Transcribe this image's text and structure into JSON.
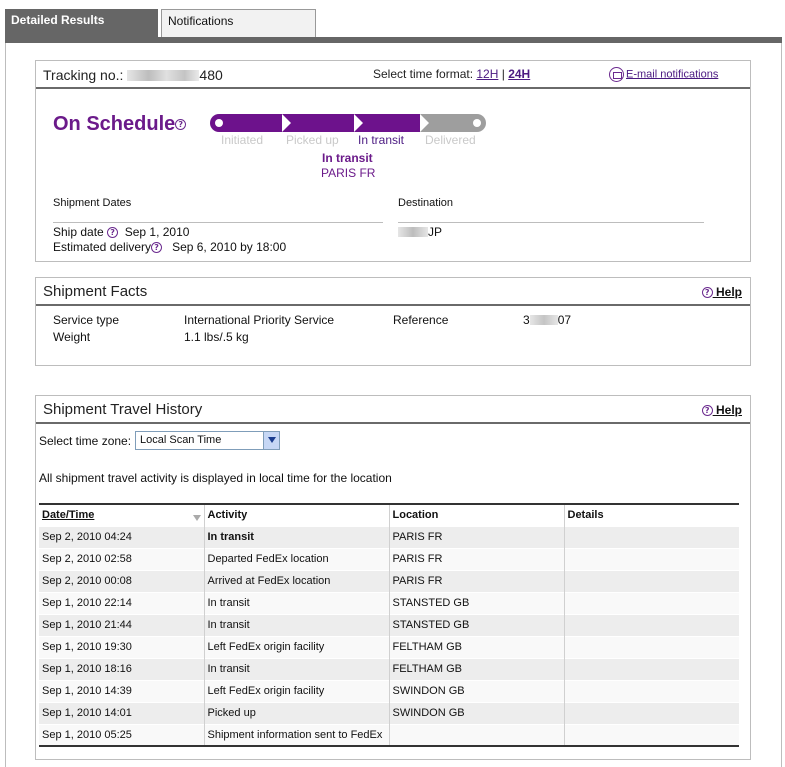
{
  "tabs": {
    "active": "Detailed Results",
    "inactive": "Notifications"
  },
  "tracking": {
    "label": "Tracking no.:",
    "number_suffix": "480",
    "time_format_label": "Select time format:",
    "format_12h": "12H",
    "separator": "|",
    "format_24h": "24H",
    "email_link": "E-mail notifications"
  },
  "status": {
    "title": "On Schedule",
    "steps": [
      "Initiated",
      "Picked up",
      "In transit",
      "Delivered"
    ],
    "current_status": "In transit",
    "current_location": "PARIS FR"
  },
  "shipment_dates": {
    "header": "Shipment Dates",
    "ship_date_label": "Ship date",
    "ship_date": "Sep 1, 2010",
    "est_delivery_label": "Estimated delivery",
    "est_delivery": "Sep 6, 2010 by 18:00"
  },
  "destination": {
    "header": "Destination",
    "value_suffix": "JP"
  },
  "facts": {
    "title": "Shipment Facts",
    "help": "Help",
    "service_type_label": "Service type",
    "service_type": "International Priority Service",
    "weight_label": "Weight",
    "weight": "1.1 lbs/.5 kg",
    "reference_label": "Reference",
    "reference_prefix": "3",
    "reference_suffix": "07"
  },
  "history": {
    "title": "Shipment Travel History",
    "help": "Help",
    "timezone_label": "Select time zone:",
    "timezone_value": "Local Scan Time",
    "note": "All shipment travel activity is displayed in local time for the location",
    "columns": [
      "Date/Time",
      "Activity",
      "Location",
      "Details"
    ],
    "rows": [
      {
        "datetime": "Sep 2, 2010 04:24",
        "activity": "In transit",
        "location": "PARIS FR",
        "details": ""
      },
      {
        "datetime": "Sep 2, 2010 02:58",
        "activity": "Departed FedEx location",
        "location": "PARIS FR",
        "details": ""
      },
      {
        "datetime": "Sep 2, 2010 00:08",
        "activity": "Arrived at FedEx location",
        "location": "PARIS FR",
        "details": ""
      },
      {
        "datetime": "Sep 1, 2010 22:14",
        "activity": "In transit",
        "location": "STANSTED GB",
        "details": ""
      },
      {
        "datetime": "Sep 1, 2010 21:44",
        "activity": "In transit",
        "location": "STANSTED GB",
        "details": ""
      },
      {
        "datetime": "Sep 1, 2010 19:30",
        "activity": "Left FedEx origin facility",
        "location": "FELTHAM GB",
        "details": ""
      },
      {
        "datetime": "Sep 1, 2010 18:16",
        "activity": "In transit",
        "location": "FELTHAM GB",
        "details": ""
      },
      {
        "datetime": "Sep 1, 2010 14:39",
        "activity": "Left FedEx origin facility",
        "location": "SWINDON GB",
        "details": ""
      },
      {
        "datetime": "Sep 1, 2010 14:01",
        "activity": "Picked up",
        "location": "SWINDON GB",
        "details": ""
      },
      {
        "datetime": "Sep 1, 2010 05:25",
        "activity": "Shipment information sent to FedEx",
        "location": "",
        "details": ""
      }
    ]
  },
  "colors": {
    "brand_purple": "#6d128c",
    "tab_gray": "#666666",
    "pending_gray": "#9e9e9e"
  }
}
